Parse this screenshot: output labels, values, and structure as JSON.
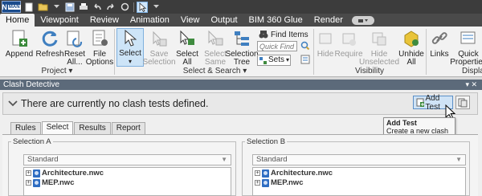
{
  "app": {
    "logo_letter": "N",
    "logo_sub": "MAN"
  },
  "ribbon_tabs": [
    "Home",
    "Viewpoint",
    "Review",
    "Animation",
    "View",
    "Output",
    "BIM 360 Glue",
    "Render"
  ],
  "ribbon": {
    "append": "Append",
    "refresh": "Refresh",
    "reset_all": "Reset\nAll...",
    "file_options": "File\nOptions",
    "select": "Select",
    "save_selection": "Save\nSelection",
    "select_all": "Select\nAll",
    "select_same": "Select\nSame",
    "selection_tree": "Selection\nTree",
    "find_items": "Find Items",
    "quick_find_placeholder": "Quick Find",
    "sets": "Sets",
    "hide": "Hide",
    "require": "Require",
    "hide_unselected": "Hide\nUnselected",
    "unhide_all": "Unhide\nAll",
    "links": "Links",
    "quick_properties": "Quick\nProperties",
    "groups": {
      "project": "Project",
      "select_search": "Select & Search",
      "visibility": "Visibility",
      "display": "Display"
    }
  },
  "panel": {
    "title": "Clash Detective",
    "status_text": "There are currently no clash tests defined.",
    "add_test_label": "Add Test",
    "tooltip_title": "Add Test",
    "tooltip_desc": "Create a new clash test.",
    "tabs": [
      "Rules",
      "Select",
      "Results",
      "Report"
    ],
    "active_tab": "Select",
    "selection_a": {
      "legend": "Selection A",
      "dropdown": "Standard",
      "items": [
        "Architecture.nwc",
        "MEP.nwc"
      ]
    },
    "selection_b": {
      "legend": "Selection B",
      "dropdown": "Standard",
      "items": [
        "Architecture.nwc",
        "MEP.nwc"
      ]
    }
  },
  "colors": {
    "accent": "#5c8fc6",
    "panel_title_bg": "#5c6a7a",
    "tab_bar_bg": "#4a4a4a"
  }
}
